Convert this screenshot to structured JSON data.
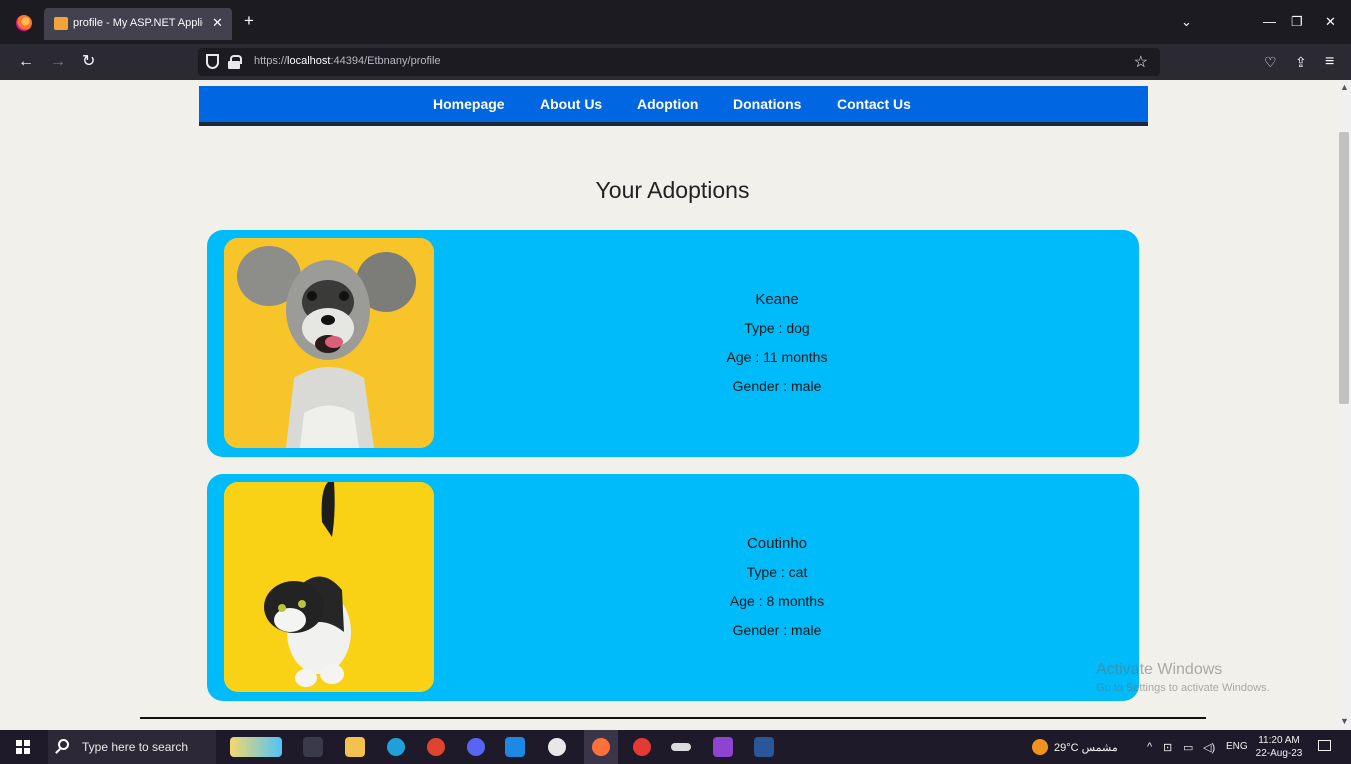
{
  "browser": {
    "tab_title": "profile - My ASP.NET Applicatio",
    "url_prefix": "https://",
    "url_host": "localhost",
    "url_path": ":44394/Etbnany/profile"
  },
  "nav": {
    "links": [
      "Homepage",
      "About Us",
      "Adoption",
      "Donations",
      "Contact Us"
    ]
  },
  "page": {
    "title": "Your Adoptions"
  },
  "adoptions": [
    {
      "name": "Keane",
      "type": "Type : dog",
      "age": "Age : 11 months",
      "gender": "Gender : male"
    },
    {
      "name": "Coutinho",
      "type": "Type : cat",
      "age": "Age : 8 months",
      "gender": "Gender : male"
    }
  ],
  "watermark": {
    "line1": "Activate Windows",
    "line2": "Go to Settings to activate Windows."
  },
  "taskbar": {
    "search_placeholder": "Type here to search",
    "weather": "29°C مشمس",
    "lang": "ENG",
    "time": "11:20 AM",
    "date": "22-Aug-23"
  }
}
